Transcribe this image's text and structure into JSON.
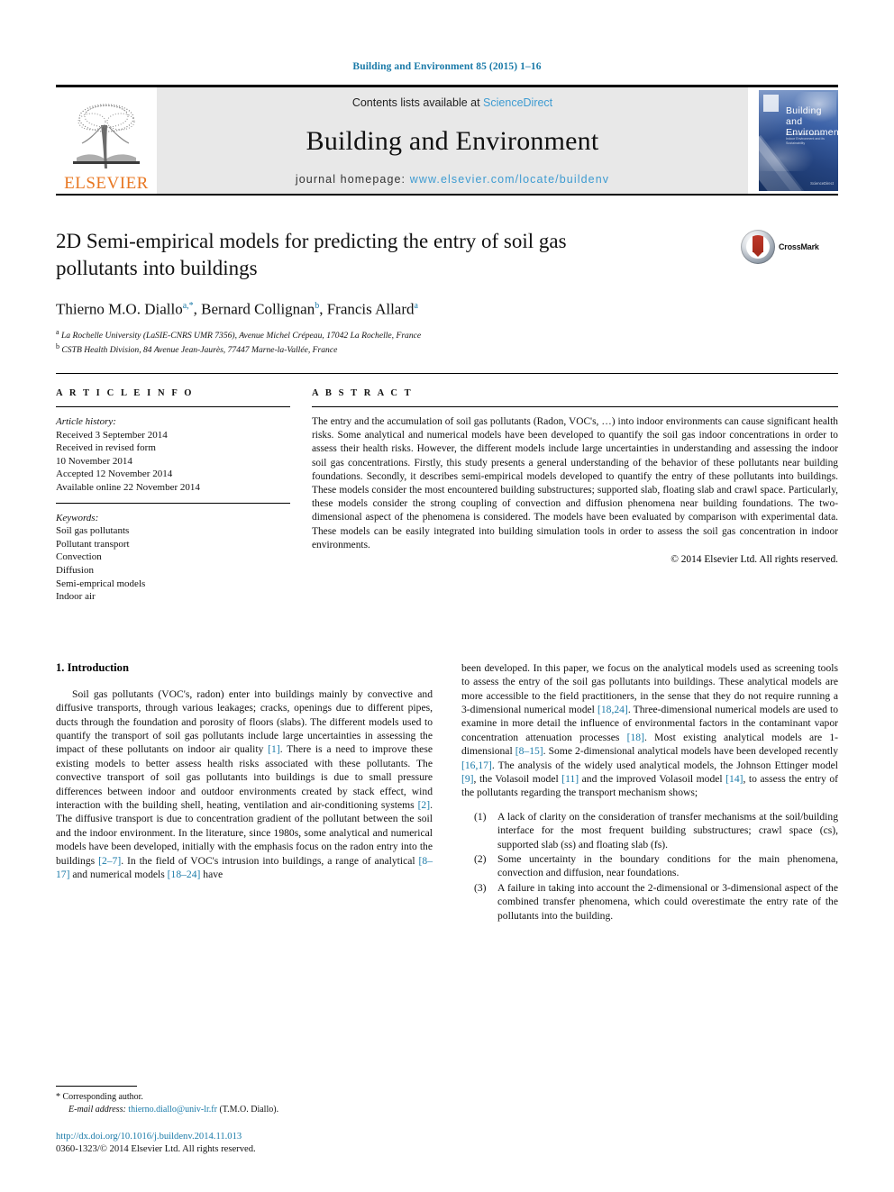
{
  "running_head": "Building and Environment 85 (2015) 1–16",
  "banner": {
    "contents_prefix": "Contents lists available at ",
    "sciencedirect": "ScienceDirect",
    "journal_title": "Building and Environment",
    "homepage_prefix": "journal homepage: ",
    "homepage_url": "www.elsevier.com/locate/buildenv",
    "publisher_wordmark": "ELSEVIER",
    "publisher_color": "#E87722",
    "cover": {
      "title_line1": "Building and",
      "title_line2": "Environment",
      "subtitle": "An International Journal of Indoor Environment and its Sustainability",
      "footer": "ScienceDirect"
    }
  },
  "article": {
    "title": "2D Semi-empirical models for predicting the entry of soil gas pollutants into buildings",
    "authors_plain": "Thierno M.O. Diallo a,*, Bernard Collignan b, Francis Allard a",
    "authors": [
      {
        "name": "Thierno M.O. Diallo",
        "marks": "a,*"
      },
      {
        "name": "Bernard Collignan",
        "marks": "b"
      },
      {
        "name": "Francis Allard",
        "marks": "a"
      }
    ],
    "affiliations": [
      {
        "mark": "a",
        "text": "La Rochelle University (LaSIE-CNRS UMR 7356), Avenue Michel Crépeau, 17042 La Rochelle, France"
      },
      {
        "mark": "b",
        "text": "CSTB Health Division, 84 Avenue Jean-Jaurès, 77447 Marne-la-Vallée, France"
      }
    ],
    "crossmark_label": "CrossMark"
  },
  "article_info": {
    "heading": "A R T I C L E   I N F O",
    "history_label": "Article history:",
    "history": [
      "Received 3 September 2014",
      "Received in revised form",
      "10 November 2014",
      "Accepted 12 November 2014",
      "Available online 22 November 2014"
    ],
    "keywords_label": "Keywords:",
    "keywords": [
      "Soil gas pollutants",
      "Pollutant transport",
      "Convection",
      "Diffusion",
      "Semi-emprical models",
      "Indoor air"
    ]
  },
  "abstract": {
    "heading": "A B S T R A C T",
    "text": "The entry and the accumulation of soil gas pollutants (Radon, VOC's, …) into indoor environments can cause significant health risks. Some analytical and numerical models have been developed to quantify the soil gas indoor concentrations in order to assess their health risks. However, the different models include large uncertainties in understanding and assessing the indoor soil gas concentrations. Firstly, this study presents a general understanding of the behavior of these pollutants near building foundations. Secondly, it describes semi-empirical models developed to quantify the entry of these pollutants into buildings. These models consider the most encountered building substructures; supported slab, floating slab and crawl space. Particularly, these models consider the strong coupling of convection and diffusion phenomena near building foundations. The two-dimensional aspect of the phenomena is considered. The models have been evaluated by comparison with experimental data. These models can be easily integrated into building simulation tools in order to assess the soil gas concentration in indoor environments.",
    "copyright": "© 2014 Elsevier Ltd. All rights reserved."
  },
  "body": {
    "section_heading": "1. Introduction",
    "left_paragraph_part1": "Soil gas pollutants (VOC's, radon) enter into buildings mainly by convective and diffusive transports, through various leakages; cracks, openings due to different pipes, ducts through the foundation and porosity of floors (slabs). The different models used to quantify the transport of soil gas pollutants include large uncertainties in assessing the impact of these pollutants on indoor air quality ",
    "ref1": "[1]",
    "left_paragraph_part2": ". There is a need to improve these existing models to better assess health risks associated with these pollutants. The convective transport of soil gas pollutants into buildings is due to small pressure differences between indoor and outdoor environments created by stack effect, wind interaction with the building shell, heating, ventilation and air-conditioning systems ",
    "ref2": "[2]",
    "left_paragraph_part3": ". The diffusive transport is due to concentration gradient of the pollutant between the soil and the indoor environment. In the literature, since 1980s, some analytical and numerical models have been developed, initially with the emphasis focus on the radon entry into the buildings ",
    "ref3": "[2–7]",
    "left_paragraph_part4": ". In the field of VOC's intrusion into buildings, a range of analytical ",
    "ref4": "[8–17]",
    "left_paragraph_part5": " and numerical models ",
    "ref5": "[18–24]",
    "left_paragraph_part6": " have",
    "right_paragraph_part1": "been developed. In this paper, we focus on the analytical models used as screening tools to assess the entry of the soil gas pollutants into buildings. These analytical models are more accessible to the field practitioners, in the sense that they do not require running a 3-dimensional numerical model ",
    "ref6": "[18,24]",
    "right_paragraph_part2": ". Three-dimensional numerical models are used to examine in more detail the influence of environmental factors in the contaminant vapor concentration attenuation processes ",
    "ref7": "[18]",
    "right_paragraph_part3": ". Most existing analytical models are 1-dimensional ",
    "ref8": "[8–15]",
    "right_paragraph_part4": ". Some 2-dimensional analytical models have been developed recently ",
    "ref9": "[16,17]",
    "right_paragraph_part5": ". The analysis of the widely used analytical models, the Johnson Ettinger model ",
    "ref10": "[9]",
    "right_paragraph_part6": ", the Volasoil model ",
    "ref11": "[11]",
    "right_paragraph_part7": " and the improved Volasoil model ",
    "ref12": "[14]",
    "right_paragraph_part8": ", to assess the entry of the pollutants regarding the transport mechanism shows;",
    "numbered_items": [
      {
        "marker": "(1)",
        "text": "A lack of clarity on the consideration of transfer mechanisms at the soil/building interface for the most frequent building substructures; crawl space (cs), supported slab (ss) and floating slab (fs)."
      },
      {
        "marker": "(2)",
        "text": "Some uncertainty in the boundary conditions for the main phenomena, convection and diffusion, near foundations."
      },
      {
        "marker": "(3)",
        "text": "A failure in taking into account the 2-dimensional or 3-dimensional aspect of the combined transfer phenomena, which could overestimate the entry rate of the pollutants into the building."
      }
    ]
  },
  "footer": {
    "corresponding_marker": "*",
    "corresponding_label": "Corresponding author.",
    "email_label": "E-mail address:",
    "email": "thierno.diallo@univ-lr.fr",
    "email_owner": "(T.M.O. Diallo).",
    "doi": "http://dx.doi.org/10.1016/j.buildenv.2014.11.013",
    "issn_line": "0360-1323/© 2014 Elsevier Ltd. All rights reserved."
  },
  "colors": {
    "link_blue": "#1a7aa8",
    "sciencedirect_blue": "#3e9bd1",
    "elsevier_orange": "#E87722"
  }
}
